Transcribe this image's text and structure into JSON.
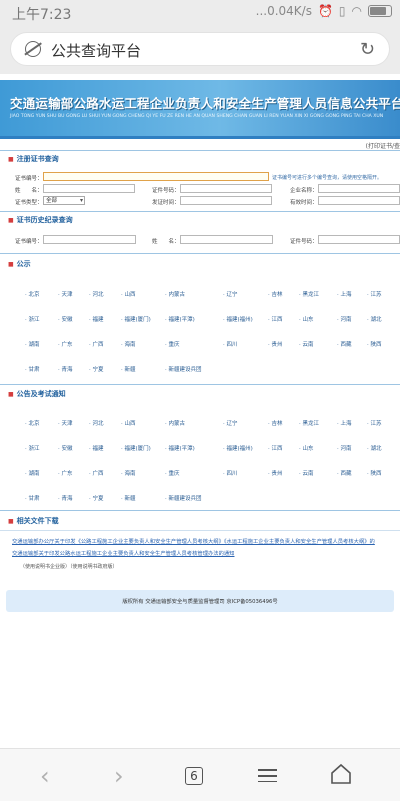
{
  "status": {
    "time": "上午7:23",
    "network": "...0.04K/s"
  },
  "browser": {
    "page_title": "公共查询平台"
  },
  "banner": {
    "title": "交通运输部公路水运工程企业负责人和安全生产管理人员信息公共平台查询",
    "pinyin": "JIAO TONG YUN SHU BU GONG LU SHUI YUN GONG CHENG QI YE FU ZE REN HE AN QUAN SHENG CHAN GUAN LI REN YUAN XIN XI GONG GONG PING TAI CHA XUN"
  },
  "top_link": "(打印证书/查",
  "section_register": {
    "title": "注册证书查询",
    "cert_no_label": "证书编号：",
    "hint": "证书编号可进行多个编号查询，请使用空格隔开。",
    "name_label": "姓　　名：",
    "cert_type_label": "证书类型：",
    "cert_type_value": "全部",
    "id_label": "证件号码：",
    "issue_label": "发证时间：",
    "company_label": "企业名称：",
    "valid_label": "有效时间："
  },
  "section_history": {
    "title": "证书历史纪录查询",
    "cert_no_label": "证书编号：",
    "name_label": "姓　　名：",
    "id_label": "证件号码："
  },
  "section_public": {
    "title": "公示",
    "rows": [
      [
        "北京",
        "天津",
        "河北",
        "山西",
        "内蒙古",
        "辽宁",
        "吉林",
        "黑龙江",
        "上海",
        "江苏"
      ],
      [
        "浙江",
        "安徽",
        "福建",
        "福建(厦门)",
        "福建(平潭)",
        "福建(福州)",
        "江西",
        "山东",
        "河南",
        "湖北"
      ],
      [
        "湖南",
        "广东",
        "广西",
        "海南",
        "重庆",
        "四川",
        "贵州",
        "云南",
        "西藏",
        "陕西"
      ],
      [
        "甘肃",
        "青海",
        "宁夏",
        "新疆",
        "新疆建设兵团"
      ]
    ]
  },
  "section_notice": {
    "title": "公告及考试通知",
    "rows": [
      [
        "北京",
        "天津",
        "河北",
        "山西",
        "内蒙古",
        "辽宁",
        "吉林",
        "黑龙江",
        "上海",
        "江苏"
      ],
      [
        "浙江",
        "安徽",
        "福建",
        "福建(厦门)",
        "福建(平潭)",
        "福建(福州)",
        "江西",
        "山东",
        "河南",
        "湖北"
      ],
      [
        "湖南",
        "广东",
        "广西",
        "海南",
        "重庆",
        "四川",
        "贵州",
        "云南",
        "西藏",
        "陕西"
      ],
      [
        "甘肃",
        "青海",
        "宁夏",
        "新疆",
        "新疆建设兵团"
      ]
    ]
  },
  "section_docs": {
    "title": "相关文件下载",
    "line1": "交通运输部办公厅关于印发《公路工程施工企业主要负责人和安全生产管理人员考核大纲》《水运工程施工企业主要负责人和安全生产管理人员考核大纲》的",
    "line2": "交通运输部关于印发公路水运工程施工企业主要负责人和安全生产管理人员考核管理办法的通知",
    "note": "（使用说明书企业版）（使用说明书政府版）"
  },
  "footer": {
    "text": "版权所有 交通运输部安全与质量监督管理司 京ICP备05036496号"
  },
  "bottom_nav": {
    "tab_count": "6"
  }
}
